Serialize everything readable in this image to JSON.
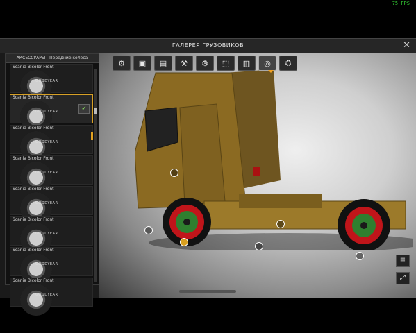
{
  "fps": "75 FPS",
  "window": {
    "title": "ГАЛЕРЕЯ ГРУЗОВИКОВ",
    "close_icon": "close-icon"
  },
  "panel": {
    "header": "АКСЕССУАРЫ - Передние колеса",
    "items": [
      {
        "label": "Scania Bicolor Front",
        "selected": false
      },
      {
        "label": "Scania Bicolor Front",
        "selected": true
      },
      {
        "label": "Scania Bicolor Front",
        "selected": false
      },
      {
        "label": "Scania Bicolor Front",
        "selected": false
      },
      {
        "label": "Scania Bicolor Front",
        "selected": false
      },
      {
        "label": "Scania Bicolor Front",
        "selected": false
      },
      {
        "label": "Scania Bicolor Front",
        "selected": false
      },
      {
        "label": "Scania Bicolor Front",
        "selected": false
      }
    ],
    "tire_brand": "GOODYEAR",
    "check_icon": "✓"
  },
  "toolbar": {
    "tools": [
      {
        "icon": "⚙",
        "name": "gallery-tool-1"
      },
      {
        "icon": "▣",
        "name": "gallery-tool-2"
      },
      {
        "icon": "▤",
        "name": "gallery-tool-3"
      },
      {
        "icon": "⚒",
        "name": "gallery-tool-4"
      },
      {
        "icon": "⚙",
        "name": "gallery-tool-5"
      },
      {
        "icon": "⬚",
        "name": "gallery-tool-6"
      },
      {
        "icon": "▥",
        "name": "gallery-tool-7"
      },
      {
        "icon": "◎",
        "name": "gallery-tool-8"
      },
      {
        "icon": "⛭",
        "name": "gallery-tool-9"
      }
    ],
    "active_index": 7
  },
  "side_buttons": {
    "lights_icon": "≣",
    "fullscreen_icon": "⤢"
  },
  "colors": {
    "accent": "#d9a020",
    "truck_body": "#8b6a22",
    "wheel_red": "#c0151a",
    "wheel_green": "#2f7f2f",
    "fps_green": "#33cc33"
  }
}
